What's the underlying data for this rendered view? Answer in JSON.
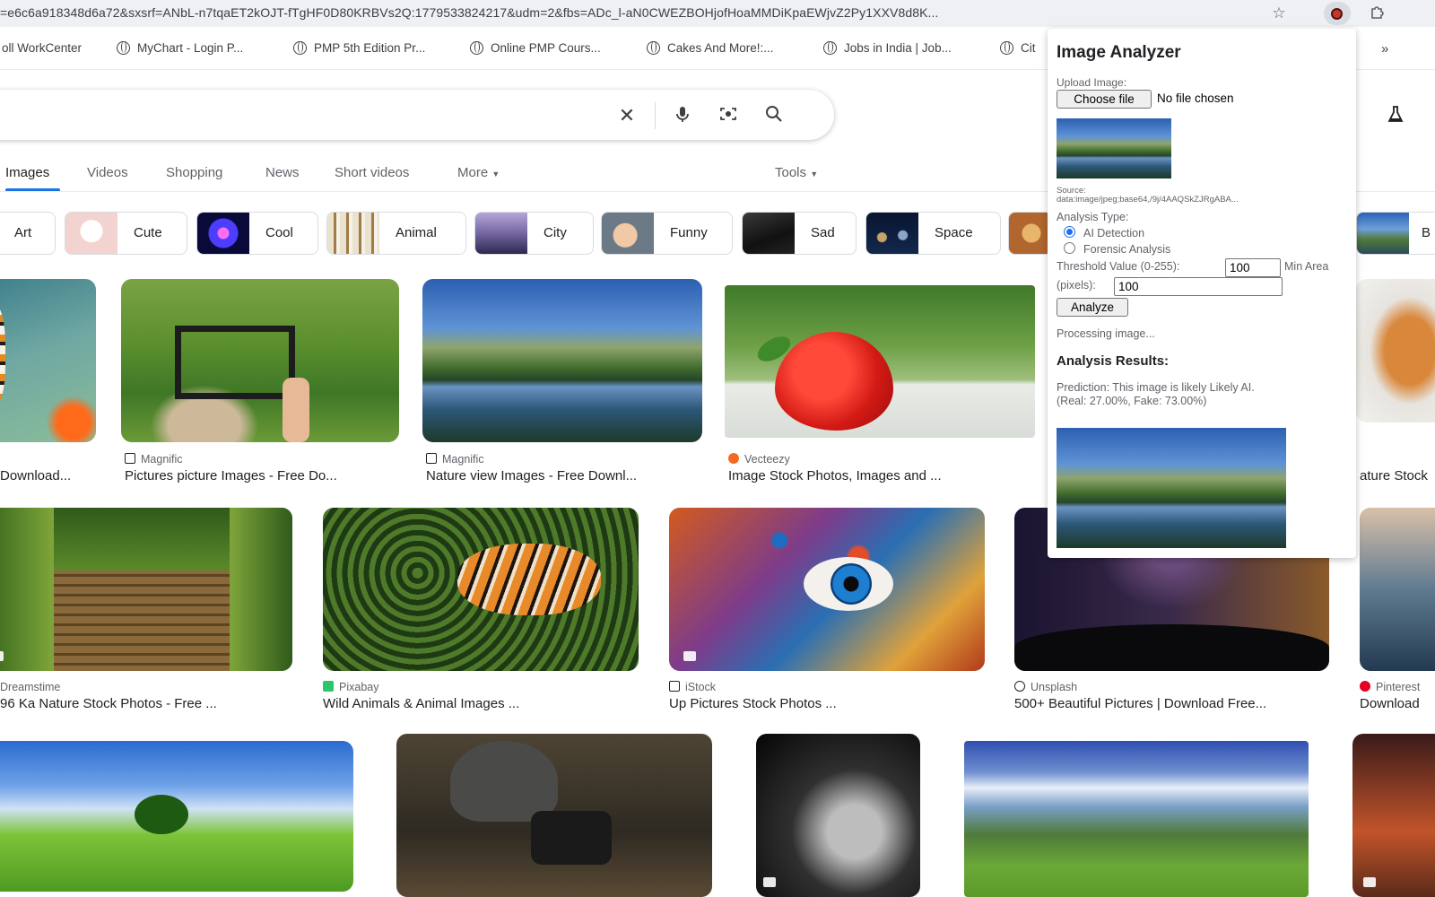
{
  "browser": {
    "url": "=e6c6a918348d6a72&sxsrf=ANbL-n7tqaET2kOJT-fTgHF0D80KRBVs2Q:1779533824217&udm=2&fbs=ADc_l-aN0CWEZBOHjofHoaMMDiKpaEWjvZ2Py1XXV8d8K..."
  },
  "bookmarks": [
    {
      "label": "oll WorkCenter"
    },
    {
      "label": "MyChart - Login P..."
    },
    {
      "label": "PMP 5th Edition Pr..."
    },
    {
      "label": "Online PMP Cours..."
    },
    {
      "label": "Cakes And More!:..."
    },
    {
      "label": "Jobs in India | Job..."
    },
    {
      "label": "Cit"
    }
  ],
  "bookmarks_more": "»",
  "nav_tabs": [
    {
      "label": "Images"
    },
    {
      "label": "Videos"
    },
    {
      "label": "Shopping"
    },
    {
      "label": "News"
    },
    {
      "label": "Short videos"
    },
    {
      "label": "More"
    },
    {
      "label": "Tools"
    }
  ],
  "chips": [
    {
      "label": "Art"
    },
    {
      "label": "Cute"
    },
    {
      "label": "Cool"
    },
    {
      "label": "Animal"
    },
    {
      "label": "City"
    },
    {
      "label": "Funny"
    },
    {
      "label": "Sad"
    },
    {
      "label": "Space"
    },
    {
      "label": "B"
    }
  ],
  "results": [
    {
      "source": "",
      "title": "Download..."
    },
    {
      "source": "Magnific",
      "title": "Pictures picture Images - Free Do..."
    },
    {
      "source": "Magnific",
      "title": "Nature view Images - Free Downl..."
    },
    {
      "source": "Vecteezy",
      "title": "Image Stock Photos, Images and ..."
    },
    {
      "source": "",
      "title": "ature Stock"
    },
    {
      "source": "Dreamstime",
      "title": "96 Ka Nature Stock Photos - Free ..."
    },
    {
      "source": "Pixabay",
      "title": "Wild Animals & Animal Images ..."
    },
    {
      "source": "iStock",
      "title": "Up Pictures Stock Photos ..."
    },
    {
      "source": "Unsplash",
      "title": "500+ Beautiful Pictures | Download Free..."
    },
    {
      "source": "Pinterest",
      "title": "Download"
    }
  ],
  "popup": {
    "title": "Image Analyzer",
    "upload_label": "Upload Image:",
    "choose_file": "Choose file",
    "no_file": "No file chosen",
    "source_label": "Source:",
    "source_value": "data:image/jpeg;base64,/9j/4AAQSkZJRgABA...",
    "analysis_type_label": "Analysis Type:",
    "option_ai": "AI Detection",
    "option_forensic": "Forensic Analysis",
    "threshold_label": "Threshold Value (0-255):",
    "threshold_value": "100",
    "min_area_label": "Min Area",
    "pixels_label": "(pixels):",
    "min_area_value": "100",
    "analyze_button": "Analyze",
    "processing": "Processing image...",
    "results_heading": "Analysis Results:",
    "prediction_line1": "Prediction: This image is likely Likely AI.",
    "prediction_line2": "(Real: 27.00%, Fake: 73.00%)"
  },
  "colors": {
    "accent": "#1a73e8",
    "popup_bg": "#ffffff",
    "extension_icon": "#c0392b"
  }
}
